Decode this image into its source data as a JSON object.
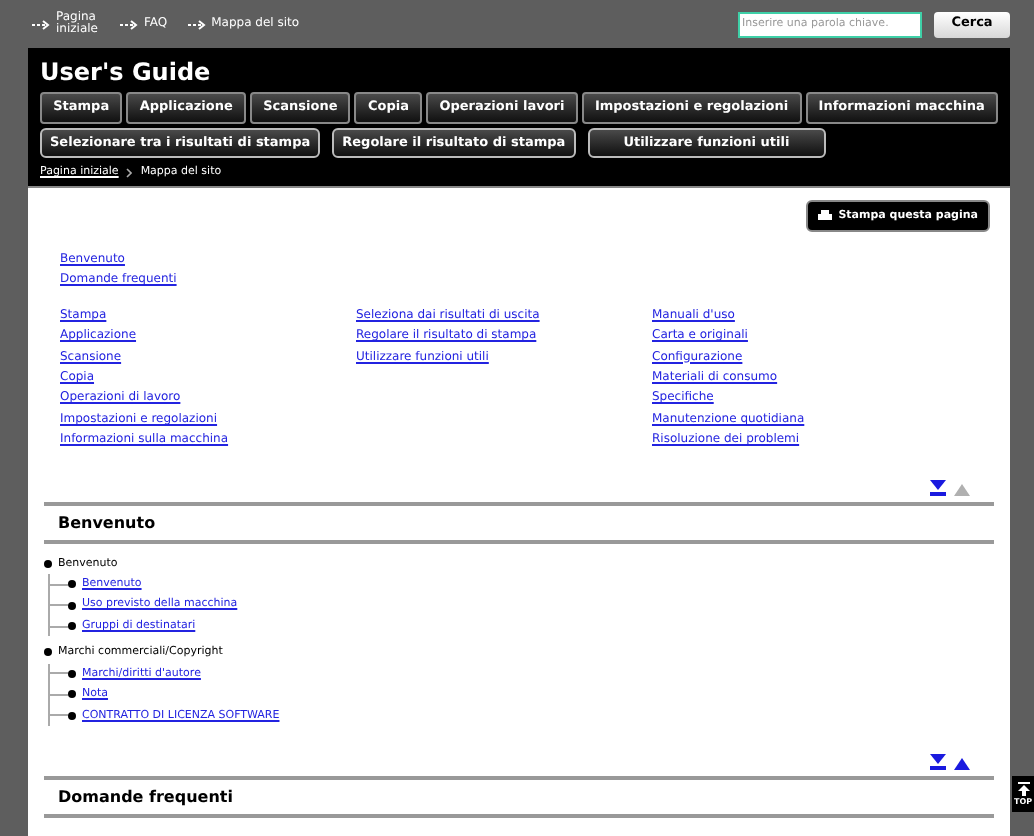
{
  "top_links": [
    {
      "label": "Pagina iniziale"
    },
    {
      "label": "FAQ"
    },
    {
      "label": "Mappa del sito"
    }
  ],
  "search": {
    "placeholder": "Inserire una parola chiave.",
    "button": "Cerca"
  },
  "header": {
    "title": "User's Guide",
    "nav_primary": [
      "Stampa",
      "Applicazione",
      "Scansione",
      "Copia",
      "Operazioni lavori",
      "Impostazioni e regolazioni",
      "Informazioni macchina"
    ],
    "nav_secondary": [
      "Selezionare tra i risultati di stampa",
      "Regolare il risultato di stampa",
      "Utilizzare funzioni utili"
    ]
  },
  "breadcrumb": [
    {
      "label": "Pagina iniziale",
      "kind": "link"
    },
    {
      "label": "Mappa del sito",
      "kind": "current"
    }
  ],
  "print_button": "Stampa questa pagina",
  "site_map": {
    "top_links": [
      "Benvenuto",
      "Domande frequenti"
    ],
    "columns": [
      [
        "Stampa",
        "Applicazione",
        "Scansione",
        "Copia",
        "Operazioni di lavoro",
        "Impostazioni e regolazioni",
        "Informazioni sulla macchina"
      ],
      [
        "Seleziona dai risultati di uscita",
        "Regolare il risultato di stampa",
        "Utilizzare funzioni utili"
      ],
      [
        "Manuali d'uso",
        "Carta e originali",
        "Configurazione",
        "Materiali di consumo",
        "Specifiche",
        "Manutenzione quotidiana",
        "Risoluzione dei problemi"
      ]
    ]
  },
  "sections": [
    {
      "title": "Benvenuto",
      "arrows": {
        "down_disabled": false,
        "up_disabled": true
      },
      "groups": [
        {
          "label": "Benvenuto",
          "items": [
            "Benvenuto",
            "Uso previsto della macchina",
            "Gruppi di destinatari"
          ]
        },
        {
          "label": "Marchi commerciali/Copyright",
          "items": [
            "Marchi/diritti d'autore",
            "Nota",
            "CONTRATTO DI LICENZA SOFTWARE"
          ]
        }
      ]
    },
    {
      "title": "Domande frequenti",
      "arrows": {
        "down_disabled": false,
        "up_disabled": false
      }
    }
  ],
  "top_button": "TOP"
}
